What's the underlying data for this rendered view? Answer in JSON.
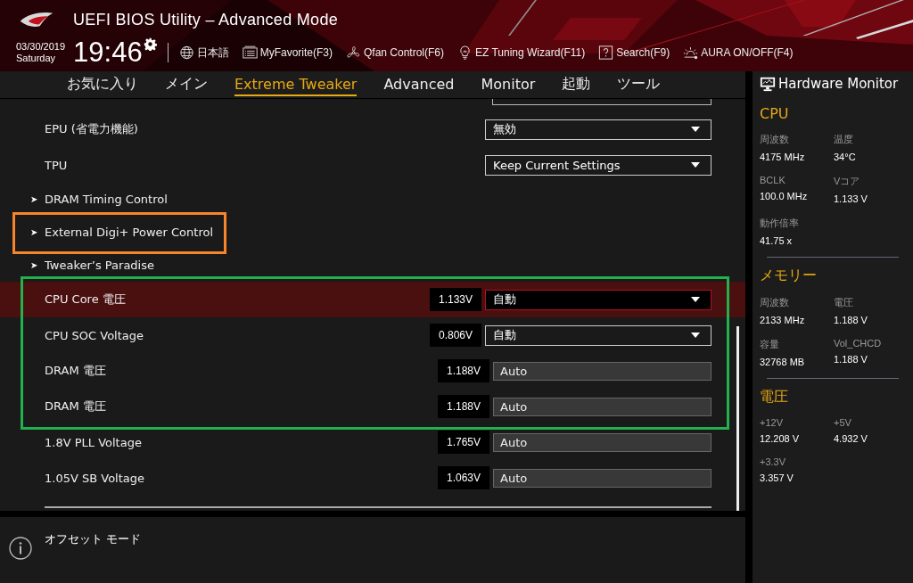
{
  "header": {
    "title": "UEFI BIOS Utility – Advanced Mode",
    "date": "03/30/2019",
    "weekday": "Saturday",
    "time": "19:46",
    "toolbar": [
      {
        "kind": "globe",
        "label": "日本語"
      },
      {
        "kind": "list",
        "label": "MyFavorite(F3)"
      },
      {
        "kind": "fan",
        "label": "Qfan Control(F6)"
      },
      {
        "kind": "bulb",
        "label": "EZ Tuning Wizard(F11)"
      },
      {
        "kind": "help",
        "label": "Search(F9)"
      },
      {
        "kind": "aura",
        "label": "AURA ON/OFF(F4)"
      }
    ]
  },
  "tabs": [
    {
      "label": "お気に入り",
      "selected": false
    },
    {
      "label": "メイン",
      "selected": false
    },
    {
      "label": "Extreme Tweaker",
      "selected": true
    },
    {
      "label": "Advanced",
      "selected": false
    },
    {
      "label": "Monitor",
      "selected": false
    },
    {
      "label": "起動",
      "selected": false
    },
    {
      "label": "ツール",
      "selected": false
    }
  ],
  "settings": [
    {
      "kind": "setting",
      "label": "EPU (省電力機能)",
      "control": {
        "kind": "dropdown",
        "value": "無効"
      },
      "selected": false
    },
    {
      "kind": "setting",
      "label": "TPU",
      "control": {
        "kind": "dropdown",
        "value": "Keep Current Settings"
      },
      "selected": false
    },
    {
      "kind": "submenu",
      "label": "DRAM Timing Control",
      "arrow": "➤"
    },
    {
      "kind": "submenu",
      "label": "External Digi+ Power Control",
      "arrow": "➤",
      "color": "#f7862a"
    },
    {
      "kind": "submenu",
      "label": "Tweaker’s Paradise",
      "arrow": "➤"
    },
    {
      "kind": "group",
      "color": "#22b14c",
      "rows": [
        {
          "kind": "setting",
          "label": "CPU Core 電圧",
          "reading": "1.133V",
          "control": {
            "kind": "dropdown",
            "value": "自動"
          },
          "selected": true
        },
        {
          "kind": "setting",
          "label": "CPU SOC Voltage",
          "reading": "0.806V",
          "control": {
            "kind": "dropdown",
            "value": "自動"
          },
          "selected": false
        },
        {
          "kind": "setting",
          "label": "DRAM 電圧",
          "reading": "1.188V",
          "control": {
            "kind": "field",
            "value": "Auto"
          },
          "selected": false
        },
        {
          "kind": "setting",
          "label": "DRAM 電圧",
          "reading": "1.188V",
          "control": {
            "kind": "field",
            "value": "Auto"
          },
          "selected": false
        }
      ]
    },
    {
      "kind": "setting",
      "label": "1.8V PLL Voltage",
      "reading": "1.765V",
      "control": {
        "kind": "field",
        "value": "Auto"
      },
      "selected": false
    },
    {
      "kind": "setting",
      "label": "1.05V SB Voltage",
      "reading": "1.063V",
      "control": {
        "kind": "field",
        "value": "Auto"
      },
      "selected": false
    }
  ],
  "help": {
    "text": "オフセット モード"
  },
  "hardware_monitor": {
    "title": "Hardware Monitor",
    "sections": [
      {
        "title": "CPU",
        "items": [
          {
            "label": "周波数",
            "value": "4175 MHz"
          },
          {
            "label": "温度",
            "value": "34°C"
          },
          {
            "label": "BCLK",
            "value": "100.0 MHz"
          },
          {
            "label": "Vコア",
            "value": "1.133 V"
          },
          {
            "label": "動作倍率",
            "value": "41.75 x"
          }
        ]
      },
      {
        "title": "メモリー",
        "items": [
          {
            "label": "周波数",
            "value": "2133 MHz"
          },
          {
            "label": "電圧",
            "value": "1.188 V"
          },
          {
            "label": "容量",
            "value": "32768 MB"
          },
          {
            "label": "Vol_CHCD",
            "value": "1.188 V"
          }
        ]
      },
      {
        "title": "電圧",
        "items": [
          {
            "label": "+12V",
            "value": "12.208 V"
          },
          {
            "label": "+5V",
            "value": "4.932 V"
          },
          {
            "label": "+3.3V",
            "value": "3.357 V"
          }
        ]
      }
    ]
  }
}
